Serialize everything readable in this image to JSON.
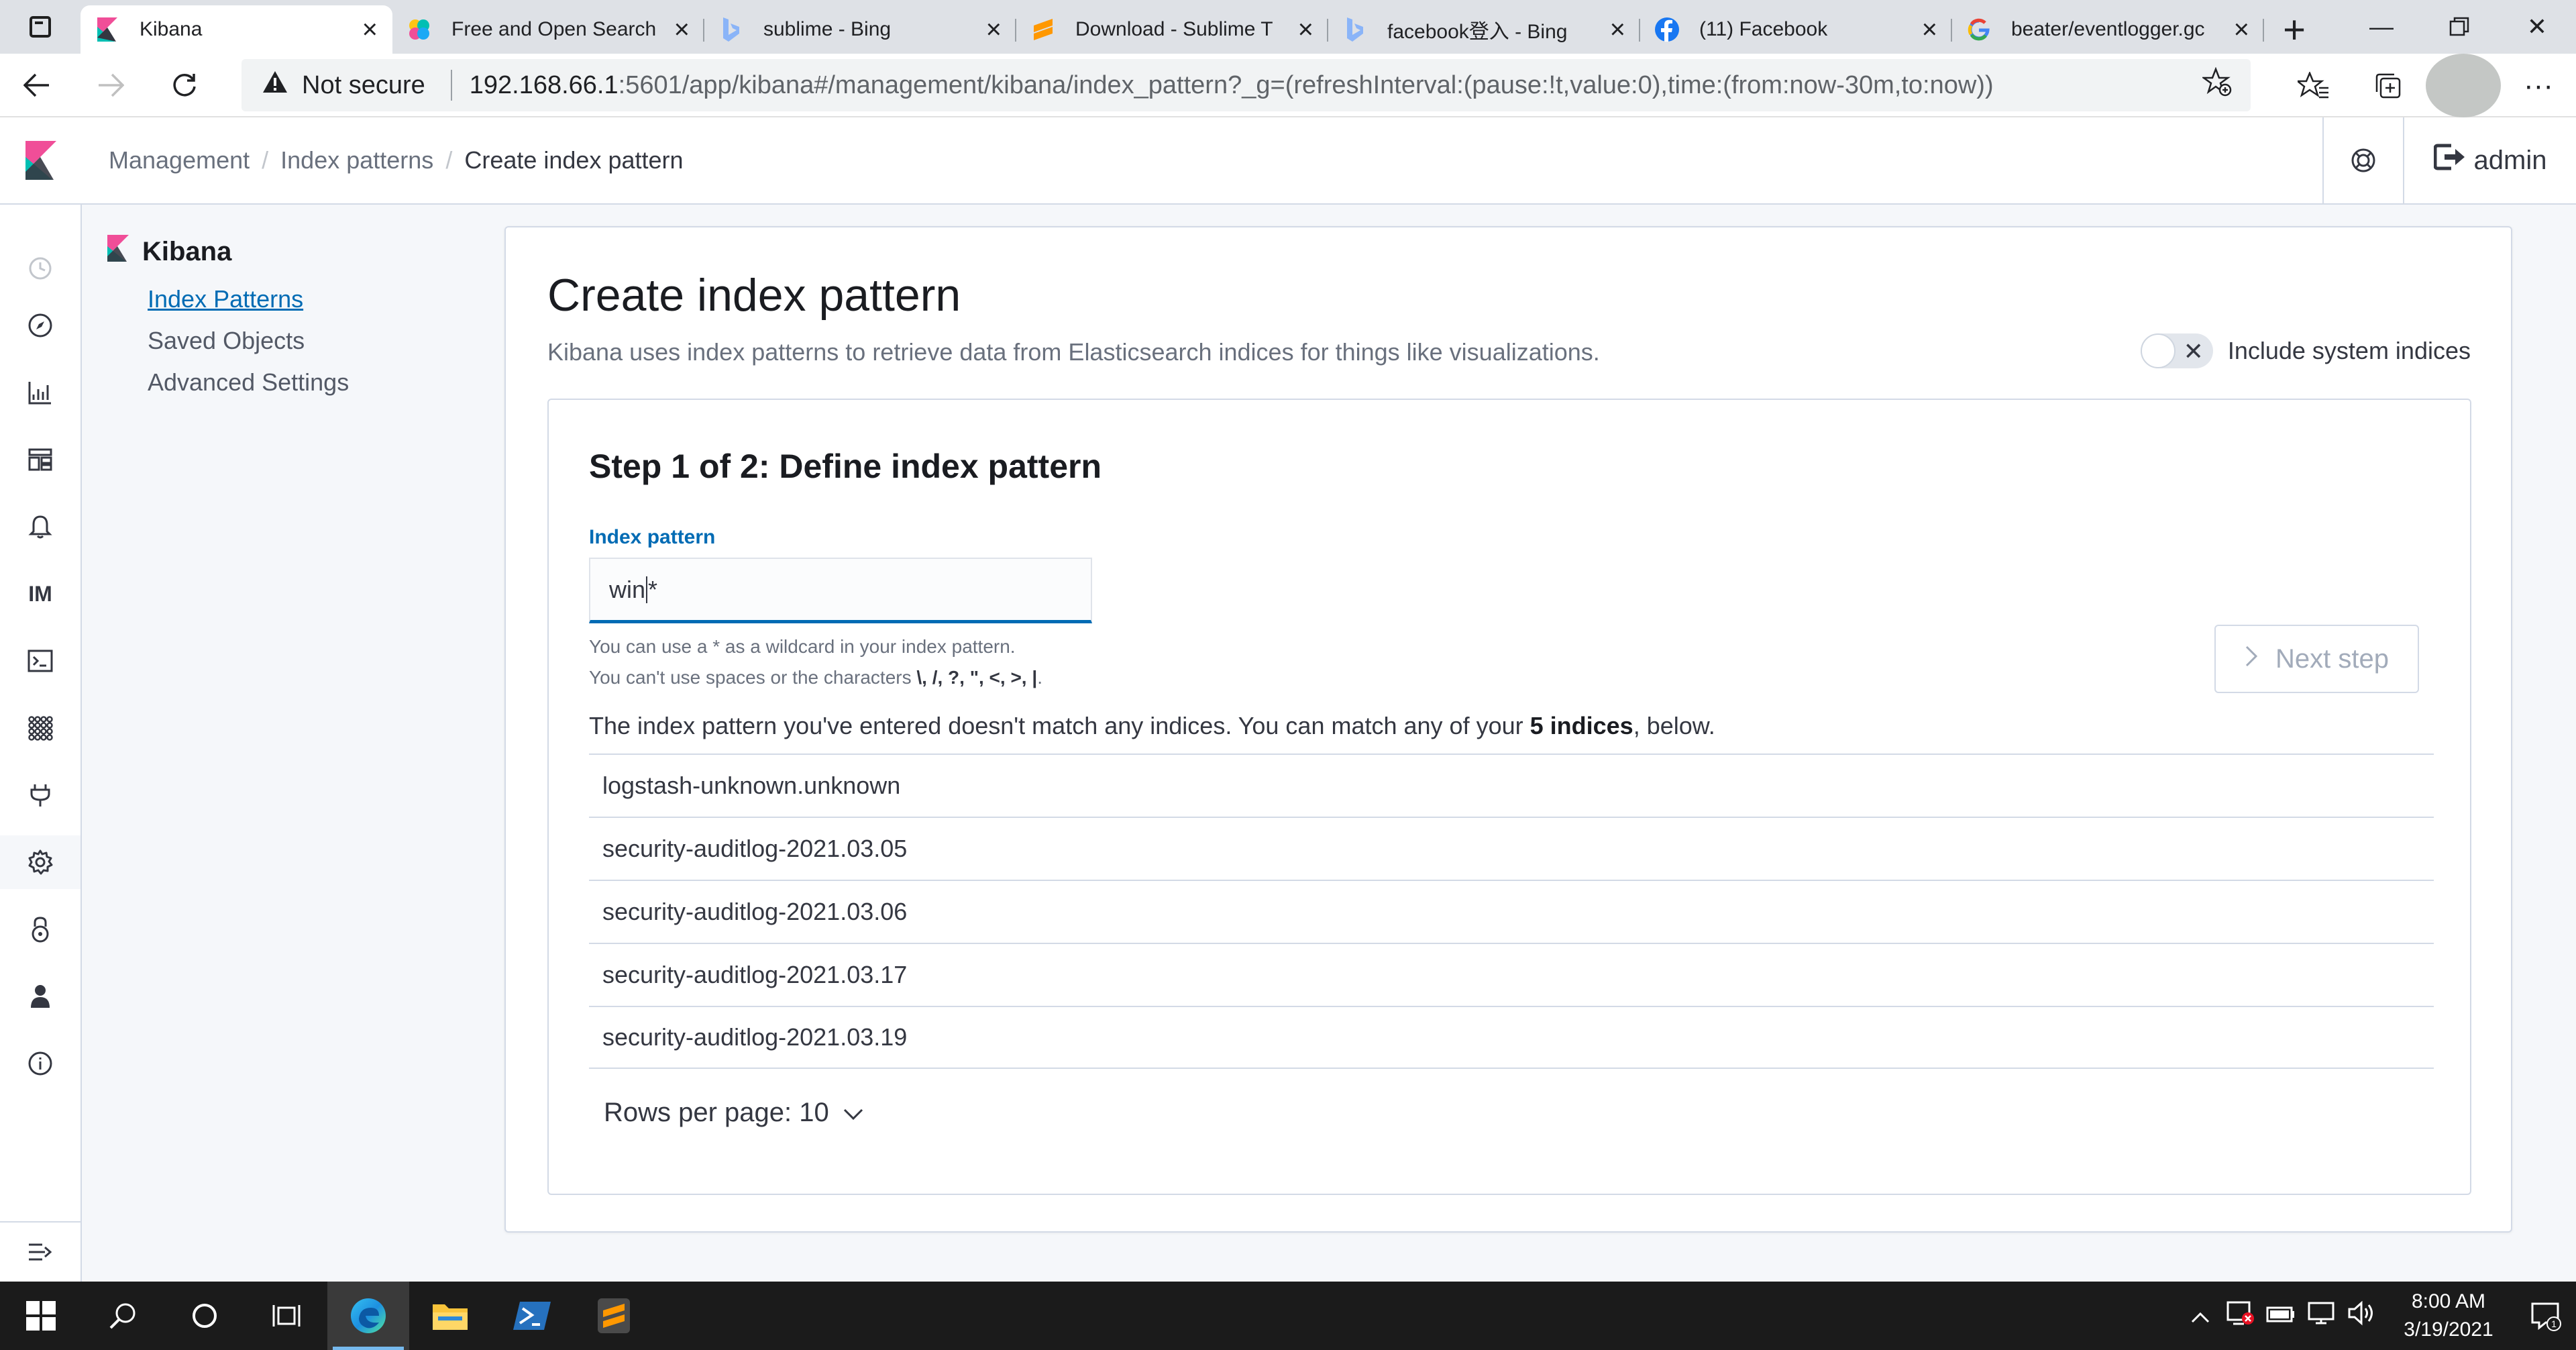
{
  "browser": {
    "tabs": [
      {
        "title": "Kibana",
        "icon": "kibana-favicon",
        "active": true
      },
      {
        "title": "Free and Open Search",
        "icon": "elastic-favicon",
        "active": false
      },
      {
        "title": "sublime - Bing",
        "icon": "bing-favicon",
        "active": false
      },
      {
        "title": "Download - Sublime T",
        "icon": "sublime-favicon",
        "active": false
      },
      {
        "title": "facebook登入 - Bing",
        "icon": "bing-favicon",
        "active": false
      },
      {
        "title": "(11) Facebook",
        "icon": "facebook-favicon",
        "active": false
      },
      {
        "title": "beater/eventlogger.gc",
        "icon": "google-favicon",
        "active": false
      }
    ],
    "address": {
      "security_label": "Not secure",
      "host": "192.168.66.1",
      "path": ":5601/app/kibana#/management/kibana/index_pattern?_g=(refreshInterval:(pause:!t,value:0),time:(from:now-30m,to:now))"
    }
  },
  "header": {
    "breadcrumbs": [
      "Management",
      "Index patterns",
      "Create index pattern"
    ],
    "user": "admin"
  },
  "sidebar": {
    "app_title": "Kibana",
    "items": [
      "Index Patterns",
      "Saved Objects",
      "Advanced Settings"
    ]
  },
  "nav_icons": {
    "monitoring": "IM"
  },
  "page": {
    "title": "Create index pattern",
    "description": "Kibana uses index patterns to retrieve data from Elasticsearch indices for things like visualizations.",
    "toggle_label": "Include system indices",
    "step_title": "Step 1 of 2: Define index pattern",
    "field_label": "Index pattern",
    "field_value_before_cursor": "win",
    "field_value_after_cursor": "*",
    "help_line1": "You can use a * as a wildcard in your index pattern.",
    "help_line2_prefix": "You can't use spaces or the characters ",
    "help_line2_chars": "\\, /, ?, \", <, >, |",
    "help_line2_suffix": ".",
    "next_button": "Next step",
    "nomatch_prefix": "The index pattern you've entered doesn't match any indices. You can match any of your ",
    "nomatch_count": "5 indices",
    "nomatch_suffix": ", below.",
    "indices": [
      "logstash-unknown.unknown",
      "security-auditlog-2021.03.05",
      "security-auditlog-2021.03.06",
      "security-auditlog-2021.03.17",
      "security-auditlog-2021.03.19"
    ],
    "rows_per_page": "Rows per page: 10"
  },
  "taskbar": {
    "time": "8:00 AM",
    "date": "3/19/2021",
    "notification_count": "1"
  }
}
